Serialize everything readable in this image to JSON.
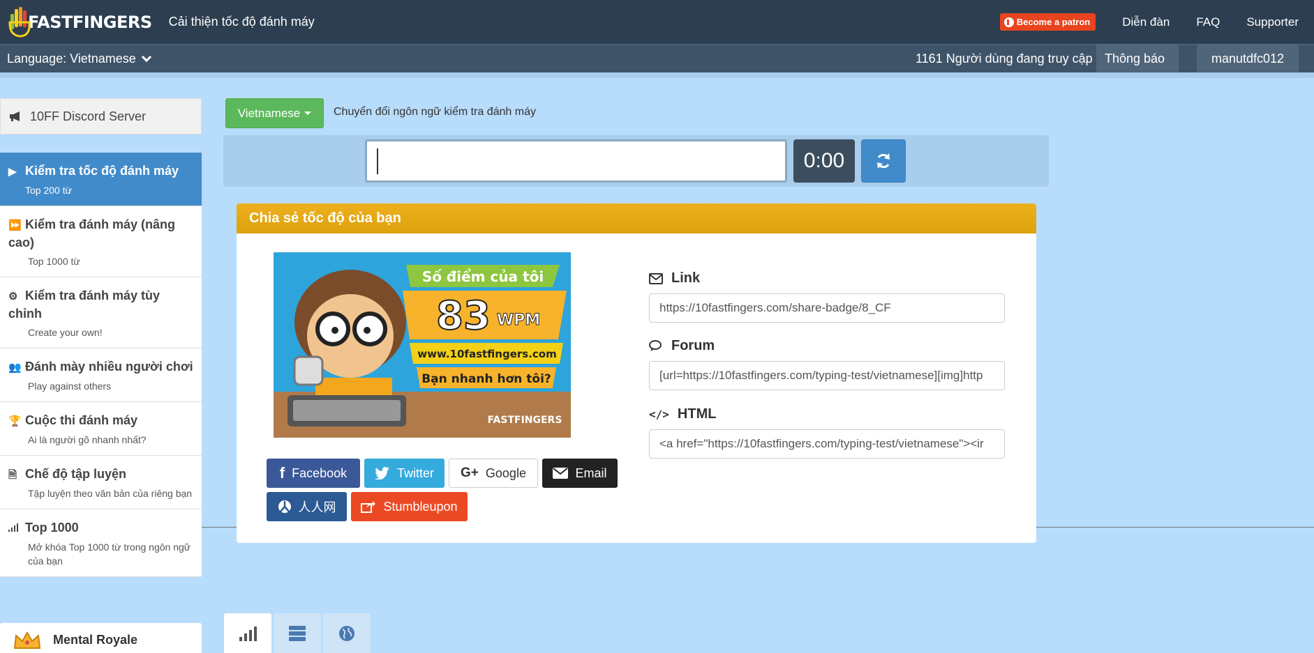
{
  "header": {
    "logo_text_ten": "10",
    "logo_text": "FASTFINGERS",
    "tagline": "Cải thiện tốc độ đánh máy",
    "patron_label": "Become a patron",
    "nav": [
      "Diễn đàn",
      "FAQ",
      "Supporter"
    ]
  },
  "subbar": {
    "language": "Language: Vietnamese",
    "online": "1161 Người dùng đang truy cập",
    "notifications": "Thông báo",
    "username": "manutdfc012"
  },
  "sidebar": {
    "discord": "10FF Discord Server",
    "items": [
      {
        "title": "Kiểm tra tốc độ đánh máy",
        "sub": "Top 200 từ",
        "icon": "play-icon"
      },
      {
        "title": "Kiểm tra đánh máy (nâng cao)",
        "sub": "Top 1000 từ",
        "icon": "fast-forward-icon"
      },
      {
        "title": "Kiểm tra đánh máy tùy chỉnh",
        "sub": "Create your own!",
        "icon": "gears-icon"
      },
      {
        "title": "Đánh mày nhiều người chơi",
        "sub": "Play against others",
        "icon": "users-icon"
      },
      {
        "title": "Cuộc thi đánh máy",
        "sub": "Ai là người gõ nhanh nhất?",
        "icon": "trophy-icon"
      },
      {
        "title": "Chế độ tập luyện",
        "sub": "Tập luyện theo văn bản của riêng bạn",
        "icon": "document-icon"
      },
      {
        "title": "Top 1000",
        "sub": "Mở khóa Top 1000 từ trong ngôn ngữ của bạn",
        "icon": "signal-icon"
      }
    ],
    "mental_royale": "Mental Royale"
  },
  "main": {
    "language_dropdown": "Vietnamese",
    "language_desc": "Chuyển đổi ngôn ngữ kiểm tra đánh máy",
    "timer": "0:00"
  },
  "share": {
    "title": "Chia sẻ tốc độ của bạn",
    "badge": {
      "heading": "Số điểm của tôi",
      "score": "83",
      "unit": "WPM",
      "site": "www.10fastfingers.com",
      "challenge": "Bạn nhanh hơn tôi?",
      "logo": "FASTFINGERS"
    },
    "buttons": {
      "facebook": "Facebook",
      "twitter": "Twitter",
      "google": "Google",
      "email": "Email",
      "renren": "人人网",
      "stumbleupon": "Stumbleupon"
    },
    "link_label": "Link",
    "link_value": "https://10fastfingers.com/share-badge/8_CF",
    "forum_label": "Forum",
    "forum_value": "[url=https://10fastfingers.com/typing-test/vietnamese][img]http",
    "html_label": "HTML",
    "html_value": "<a href=\"https://10fastfingers.com/typing-test/vietnamese\"><ir"
  },
  "colors": {
    "navbar": "#2c3e50",
    "active_blue": "#428bca",
    "green": "#5cb85c",
    "share_header": "#e4a80d",
    "background": "#b8dcfb"
  }
}
